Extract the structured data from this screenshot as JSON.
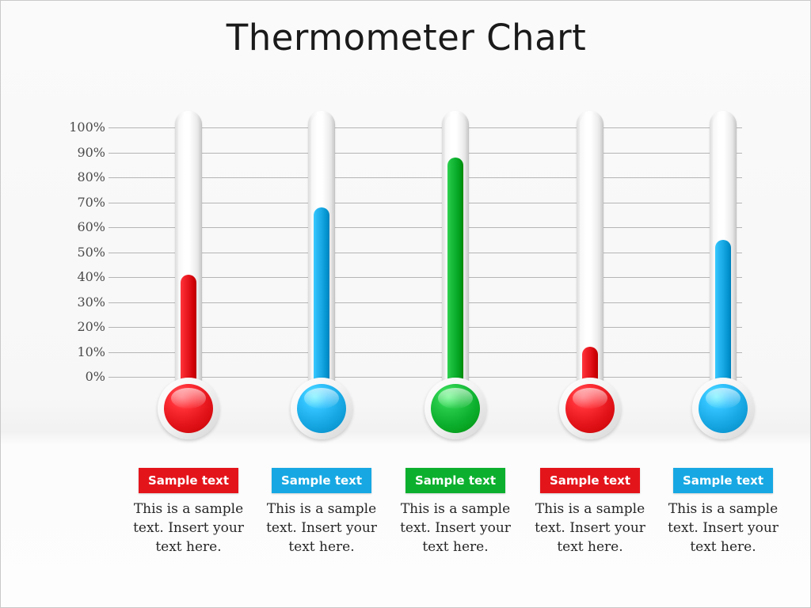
{
  "slide": {
    "title": "Thermometer Chart",
    "background_color": "#fbfbfb",
    "border_color": "#c9c9c9"
  },
  "axis": {
    "unit": "%",
    "ticks": [
      "100%",
      "90%",
      "80%",
      "70%",
      "60%",
      "50%",
      "40%",
      "30%",
      "20%",
      "10%",
      "0%"
    ],
    "grid": true,
    "gridline_color": "#b5b5b5"
  },
  "colors": {
    "red": "#e4141b",
    "blue": "#17a8e3",
    "green": "#0cb02e"
  },
  "thermometers": [
    {
      "index": 1,
      "color_name": "red",
      "color": "#e4141b",
      "value": 41,
      "badge_label": "Sample text",
      "caption": "This is a sample text. Insert your text here."
    },
    {
      "index": 2,
      "color_name": "blue",
      "color": "#17a8e3",
      "value": 68,
      "badge_label": "Sample text",
      "caption": "This is a sample text. Insert your text here."
    },
    {
      "index": 3,
      "color_name": "green",
      "color": "#0cb02e",
      "value": 88,
      "badge_label": "Sample text",
      "caption": "This is a sample text. Insert your text here."
    },
    {
      "index": 4,
      "color_name": "red",
      "color": "#e4141b",
      "value": 12,
      "badge_label": "Sample text",
      "caption": "This is a sample text. Insert your text here."
    },
    {
      "index": 5,
      "color_name": "blue",
      "color": "#17a8e3",
      "value": 55,
      "badge_label": "Sample text",
      "caption": "This is a sample text. Insert your text here."
    }
  ],
  "chart_data": {
    "type": "bar",
    "title": "Thermometer Chart",
    "xlabel": "",
    "ylabel": "",
    "ylim": [
      0,
      100
    ],
    "grid": true,
    "legend": "none",
    "categories": [
      "Sample text",
      "Sample text",
      "Sample text",
      "Sample text",
      "Sample text"
    ],
    "values": [
      41,
      68,
      88,
      12,
      55
    ],
    "tick_labels": [
      "0%",
      "10%",
      "20%",
      "30%",
      "40%",
      "50%",
      "60%",
      "70%",
      "80%",
      "90%",
      "100%"
    ],
    "series_colors": [
      "#e4141b",
      "#17a8e3",
      "#0cb02e",
      "#e4141b",
      "#17a8e3"
    ]
  }
}
